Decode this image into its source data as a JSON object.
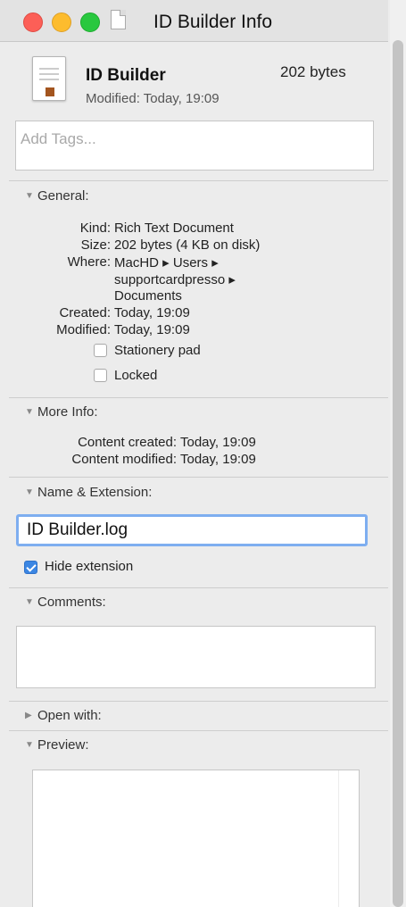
{
  "window": {
    "title": "ID Builder Info"
  },
  "header": {
    "name": "ID Builder",
    "size": "202 bytes",
    "modified": "Modified: Today, 19:09"
  },
  "tags": {
    "placeholder": "Add Tags..."
  },
  "general": {
    "title": "General:",
    "rows": [
      {
        "label": "Kind:",
        "value": "Rich Text Document"
      },
      {
        "label": "Size:",
        "value": "202 bytes (4 KB on disk)"
      },
      {
        "label": "Where:",
        "value": "MacHD ▸ Users ▸",
        "cont": [
          "supportcardpresso ▸",
          "Documents"
        ]
      },
      {
        "label": "Created:",
        "value": "Today, 19:09"
      },
      {
        "label": "Modified:",
        "value": "Today, 19:09"
      }
    ],
    "stationery_label": "Stationery pad",
    "stationery_checked": false,
    "locked_label": "Locked",
    "locked_checked": false
  },
  "more_info": {
    "title": "More Info:",
    "rows": [
      {
        "label": "Content created:",
        "value": "Today, 19:09"
      },
      {
        "label": "Content modified:",
        "value": "Today, 19:09"
      }
    ]
  },
  "name_extension": {
    "title": "Name & Extension:",
    "value": "ID Builder.log",
    "hide_extension_label": "Hide extension",
    "hide_extension_checked": true
  },
  "comments": {
    "title": "Comments:"
  },
  "open_with": {
    "title": "Open with:"
  },
  "preview": {
    "title": "Preview:"
  },
  "colors": {
    "close": "#fc5f57",
    "minimize": "#fdbc2e",
    "zoom": "#29c83f",
    "focus_ring": "#7eaef0",
    "checkbox_on": "#3b86e3"
  }
}
